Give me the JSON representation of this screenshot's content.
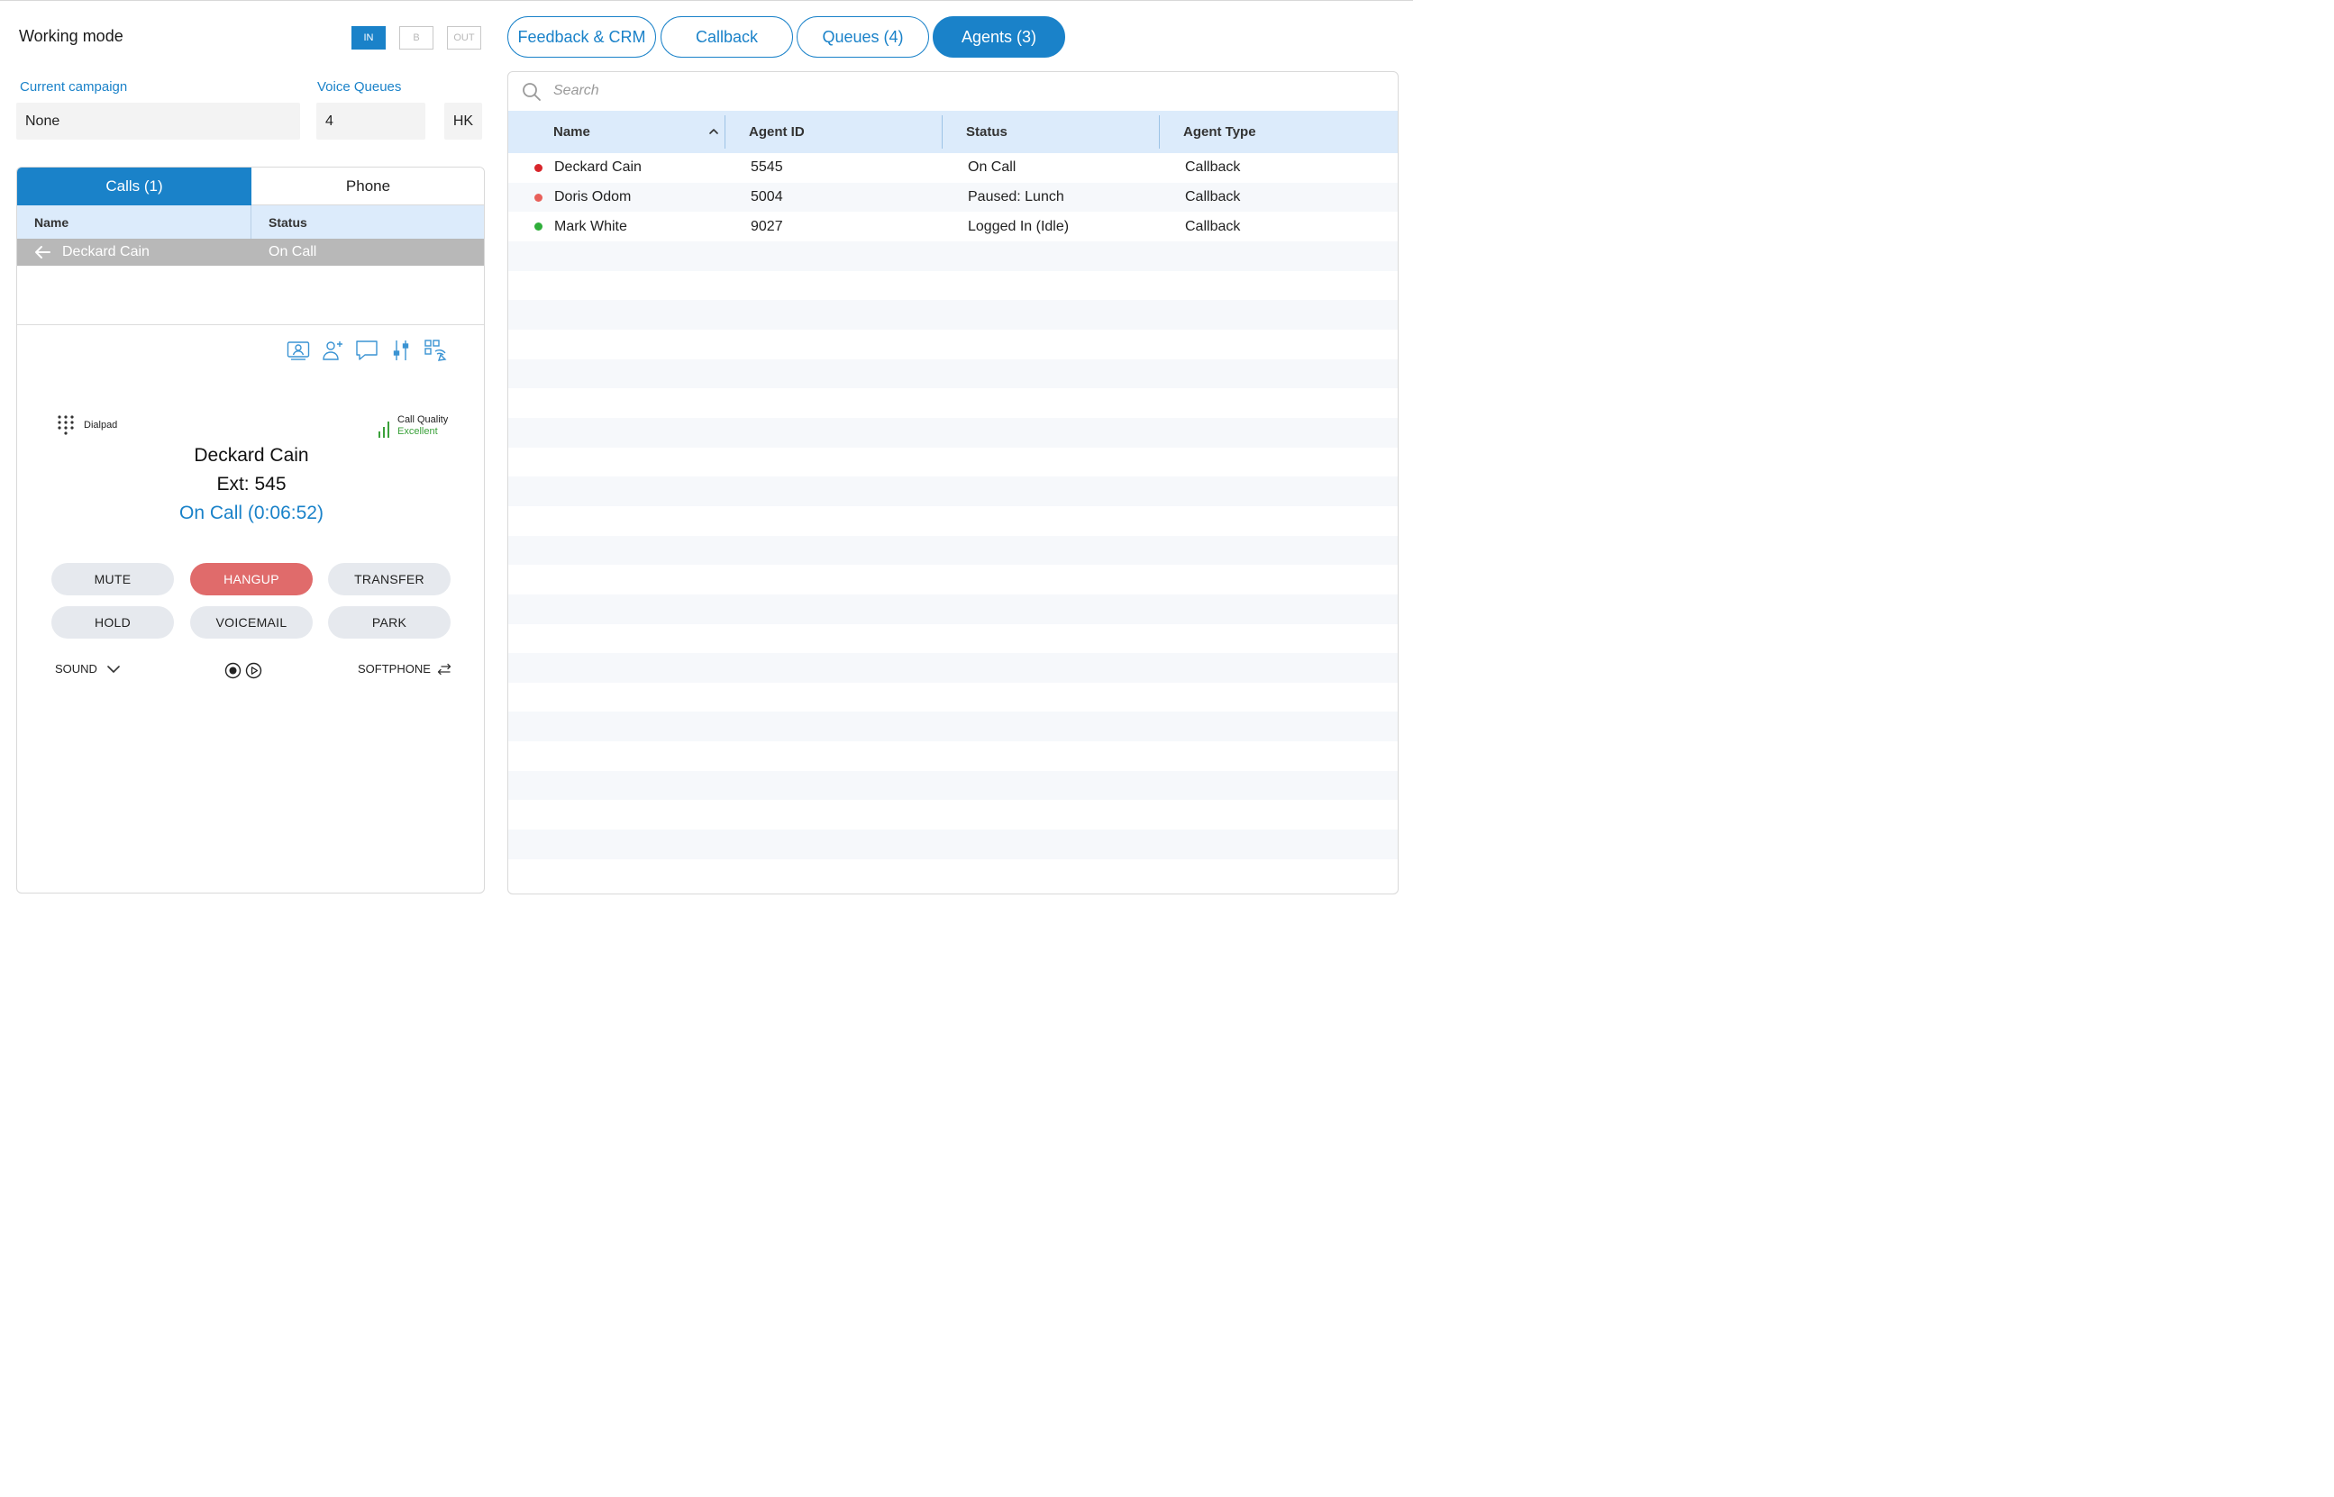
{
  "working_mode": {
    "title": "Working mode",
    "buttons": [
      {
        "label": "IN",
        "active": true
      },
      {
        "label": "B",
        "active": false
      },
      {
        "label": "OUT",
        "active": false
      }
    ]
  },
  "fields": {
    "campaign_label": "Current campaign",
    "campaign_value": "None",
    "queues_label": "Voice Queues",
    "queues_value": "4",
    "region_value": "HK"
  },
  "calls_panel": {
    "tabs": [
      {
        "label": "Calls (1)",
        "active": true
      },
      {
        "label": "Phone",
        "active": false
      }
    ],
    "columns": [
      "Name",
      "Status"
    ],
    "rows": [
      {
        "name": "Deckard Cain",
        "status": "On Call",
        "direction_icon": "arrow-left-icon"
      }
    ]
  },
  "call_toolbar": {
    "icons": [
      "contact-card-icon",
      "add-user-icon",
      "chat-icon",
      "sliders-icon",
      "qr-touch-icon"
    ]
  },
  "active_call": {
    "dialpad_label": "Dialpad",
    "quality_label": "Call Quality",
    "quality_value": "Excellent",
    "peer_name": "Deckard Cain",
    "peer_ext": "Ext: 545",
    "status": "On Call (0:06:52)",
    "buttons": [
      "MUTE",
      "HANGUP",
      "TRANSFER",
      "HOLD",
      "VOICEMAIL",
      "PARK"
    ],
    "sound_label": "SOUND",
    "softphone_label": "SOFTPHONE"
  },
  "right_tabs": [
    {
      "label": "Feedback & CRM",
      "active": false
    },
    {
      "label": "Callback",
      "active": false
    },
    {
      "label": "Queues (4)",
      "active": false
    },
    {
      "label": "Agents (3)",
      "active": true
    }
  ],
  "agents": {
    "search_placeholder": "Search",
    "columns": [
      "Name",
      "Agent ID",
      "Status",
      "Agent Type"
    ],
    "sort_column": "Name",
    "sort_direction": "ascending",
    "rows": [
      {
        "name": "Deckard Cain",
        "id": "5545",
        "status": "On Call",
        "type": "Callback",
        "status_color": "#d8262b"
      },
      {
        "name": "Doris Odom",
        "id": "5004",
        "status": "Paused: Lunch",
        "type": "Callback",
        "status_color": "#e8605a"
      },
      {
        "name": "Mark White",
        "id": "9027",
        "status": "Logged In (Idle)",
        "type": "Callback",
        "status_color": "#2fae3a"
      }
    ]
  },
  "colors": {
    "accent": "#1a82c9",
    "hangup": "#e06b6b",
    "header_bg": "#dcebfb",
    "quality_good": "#3aa13a"
  }
}
